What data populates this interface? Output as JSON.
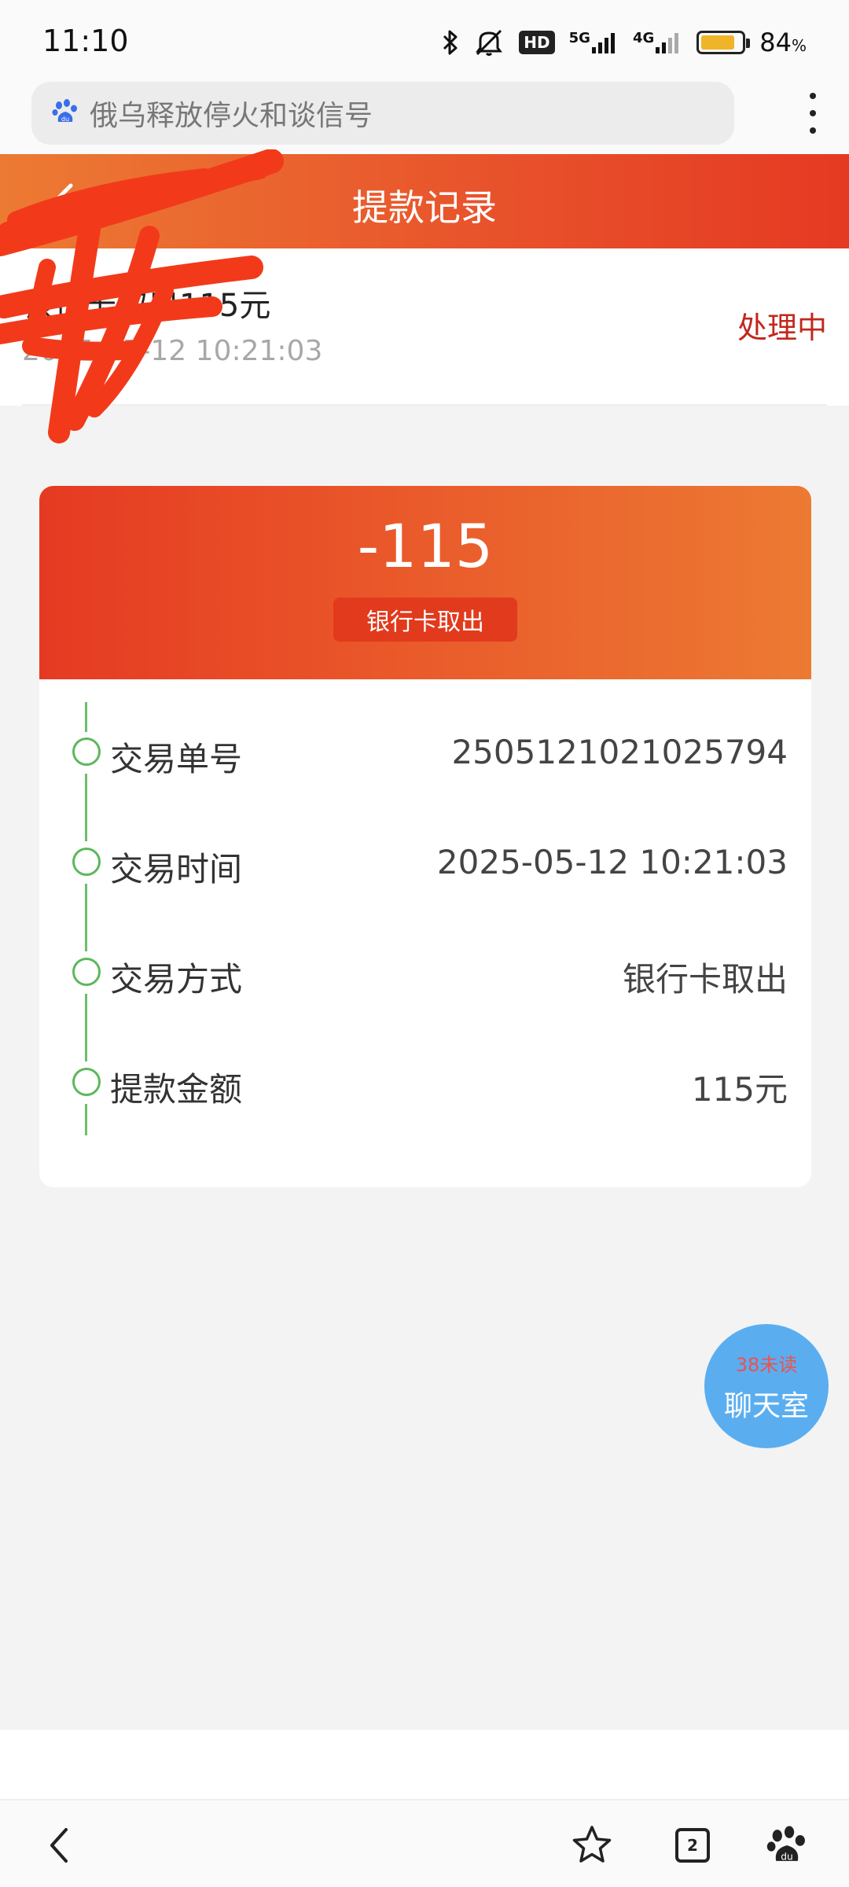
{
  "status_bar": {
    "time": "11:10",
    "icons": [
      "bluetooth-icon",
      "mute-icon",
      "hd-icon",
      "signal-5g-icon",
      "signal-4g-icon",
      "battery-icon"
    ],
    "hd_label": "HD",
    "net_5g": "5G",
    "net_4g": "4G",
    "battery_level": 0.84,
    "battery_pct": "84",
    "battery_unit": "%"
  },
  "browser": {
    "search_text": "俄乌释放停火和谈信号",
    "search_icon": "baidu-paw-icon",
    "more_icon": "more-vertical-icon"
  },
  "header": {
    "title": "提款记录",
    "back_icon": "chevron-left-icon"
  },
  "record": {
    "title": "银行卡取出115元",
    "time": "2025-05-12 10:21:03",
    "status": "处理中"
  },
  "detail": {
    "amount": "-115",
    "method_tag": "银行卡取出",
    "rows": [
      {
        "label": "交易单号",
        "value": "2505121021025794"
      },
      {
        "label": "交易时间",
        "value": "2025-05-12 10:21:03"
      },
      {
        "label": "交易方式",
        "value": "银行卡取出"
      },
      {
        "label": "提款金额",
        "value": "115元"
      }
    ]
  },
  "chat": {
    "unread": "38未读",
    "label": "聊天室"
  },
  "bottom_nav": {
    "tabs_count": "2",
    "icons": [
      "back-icon",
      "star-icon",
      "tabs-icon",
      "baidu-paw-icon"
    ]
  },
  "colors": {
    "header_accent": "#e8512b",
    "status_processing": "#c2271d",
    "timeline_green": "#5cb85c",
    "chat_blue": "#5aaef0"
  }
}
